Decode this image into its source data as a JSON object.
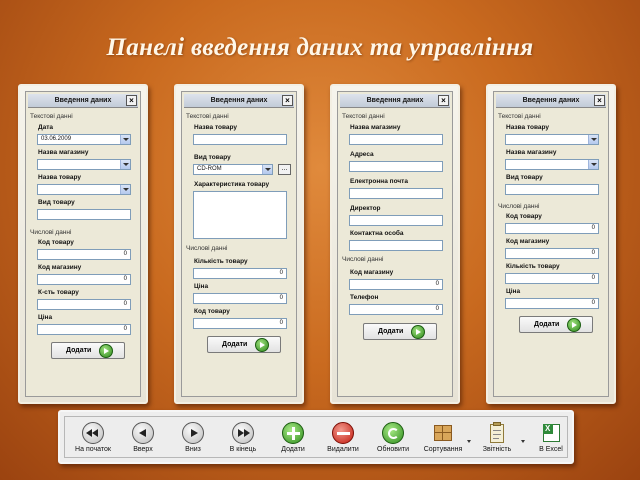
{
  "slide_title": "Панелі введення даних та управління",
  "panels": [
    {
      "title": "Введення даних",
      "text_section": "Текстові данні",
      "num_section": "Числові данні",
      "add_label": "Додати",
      "f": {
        "date_label": "Дата",
        "date_value": "03.06.2009",
        "store_label": "Назва магазину",
        "product_label": "Назва товару",
        "kind_label": "Вид товару",
        "code_label": "Код товару",
        "code_value": "0",
        "store_code_label": "Код магазину",
        "store_code_value": "0",
        "qty_label": "К-сть товару",
        "qty_value": "0",
        "price_label": "Ціна",
        "price_value": "0"
      }
    },
    {
      "title": "Введення даних",
      "text_section": "Текстові данні",
      "num_section": "Числові данні",
      "add_label": "Додати",
      "f": {
        "product_label": "Назва товару",
        "kind_label": "Вид товару",
        "kind_value": "CD-ROM",
        "dots": "...",
        "char_label": "Характеристика товару",
        "qty_label": "Кількість товару",
        "qty_value": "0",
        "price_label": "Ціна",
        "price_value": "0",
        "code_label": "Код товару",
        "code_value": "0"
      }
    },
    {
      "title": "Введення даних",
      "text_section": "Текстові данні",
      "num_section": "Числові данні",
      "add_label": "Додати",
      "f": {
        "store_label": "Назва магазину",
        "address_label": "Адреса",
        "email_label": "Електронна почта",
        "director_label": "Директор",
        "contact_label": "Контактна особа",
        "store_code_label": "Код магазину",
        "store_code_value": "0",
        "phone_label": "Телефон",
        "phone_value": "0"
      }
    },
    {
      "title": "Введення даних",
      "text_section": "Текстові данні",
      "num_section": "Числові данні",
      "add_label": "Додати",
      "f": {
        "product_label": "Назва товару",
        "store_label": "Назва магазину",
        "kind_label": "Вид товару",
        "code_label": "Код товару",
        "code_value": "0",
        "store_code_label": "Код магазину",
        "store_code_value": "0",
        "qty_label": "Кількість товару",
        "qty_value": "0",
        "price_label": "Ціна",
        "price_value": "0"
      }
    }
  ],
  "toolbar": {
    "first": "На початок",
    "up": "Вверх",
    "down": "Вниз",
    "last": "В кінець",
    "add": "Додати",
    "delete": "Видалити",
    "refresh": "Обновити",
    "sort": "Сортування",
    "reports": "Звітність",
    "excel": "В Excel"
  },
  "icons": {
    "first": "rewind-icon",
    "up": "play-back-icon",
    "down": "play-icon",
    "last": "fast-forward-icon",
    "add": "green-plus-icon",
    "delete": "red-minus-icon",
    "refresh": "green-refresh-icon",
    "sort": "boxes-icon",
    "reports": "clipboard-icon",
    "excel": "excel-icon"
  },
  "colors": {
    "background": "#c96a1f",
    "title_text": "#fff7e8",
    "window_face": "#ece9d8",
    "input_border": "#7f9db9"
  }
}
